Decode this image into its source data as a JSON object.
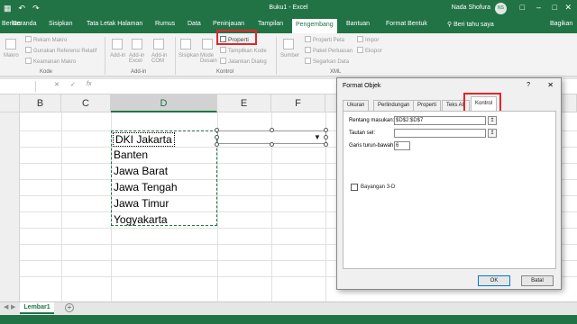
{
  "app": {
    "title": "Buku1 - Excel",
    "user": "Nada Shofura",
    "user_initials": "NS"
  },
  "tabs": [
    "Berkas",
    "Beranda",
    "Sisipkan",
    "Tata Letak Halaman",
    "Rumus",
    "Data",
    "Peninjauan",
    "Tampilan",
    "Pengembang",
    "Bantuan",
    "Format Bentuk"
  ],
  "active_tab": "Pengembang",
  "tell_me": "Beri tahu saya",
  "share": "Bagikan",
  "ribbon": {
    "kode": {
      "label": "Kode",
      "items": [
        "Rekam Makro",
        "Gunakan Referensi Relatif",
        "Keamanan Makro"
      ],
      "makro": "Makro"
    },
    "addin": {
      "label": "Add-in",
      "items": [
        "Add-in",
        "Add-in Excel",
        "Add-in COM"
      ]
    },
    "kontrol": {
      "label": "Kontrol",
      "sisipkan": "Sisipkan",
      "mode_desain": "Mode Desain",
      "properti": "Properti",
      "tampilkan_kode": "Tampilkan Kode",
      "jalankan_dialog": "Jalankan Dialog"
    },
    "xml": {
      "label": "XML",
      "sumber": "Sumber",
      "items": [
        "Properti Peta",
        "Paket Perluasan",
        "Segarkan Data"
      ],
      "items2": [
        "Impor",
        "Ekspor"
      ]
    }
  },
  "formula_bar": {
    "cancel": "✕",
    "enter": "✓",
    "fx": "fx",
    "value": ""
  },
  "columns": [
    "B",
    "C",
    "D",
    "E",
    "F"
  ],
  "selected_column": "D",
  "list_items": [
    "DKI Jakarta",
    "Banten",
    "Jawa Barat",
    "Jawa Tengah",
    "Jawa Timur",
    "Yogyakarta"
  ],
  "sheet_tab": "Lembar1",
  "add_sheet": "+",
  "dialog": {
    "title": "Format Objek",
    "help": "?",
    "close": "✕",
    "tabs": [
      "Ukuran",
      "Perlindungan",
      "Properti",
      "Teks Alt",
      "Kontrol"
    ],
    "active_tab": "Kontrol",
    "rentang_label": "Rentang masukan:",
    "rentang_value": "$D$2:$D$7",
    "tautan_label": "Tautan sel:",
    "tautan_value": "",
    "garis_label": "Garis turun-bawah:",
    "garis_value": "6",
    "bayangan_label": "Bayangan 3-D",
    "ok": "OK",
    "cancel": "Batal"
  },
  "colors": {
    "excel_green": "#217346",
    "highlight_red": "#e0262c"
  }
}
